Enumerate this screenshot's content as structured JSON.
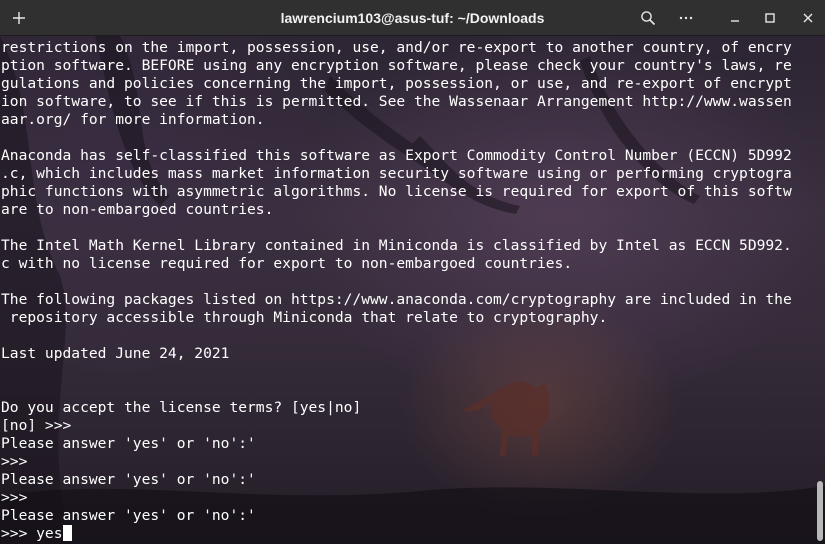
{
  "window": {
    "title": "lawrencium103@asus-tuf: ~/Downloads"
  },
  "toolbar": {
    "icons": [
      "plus-icon",
      "search-icon",
      "hamburger-menu-icon",
      "minimize-icon",
      "maximize-icon",
      "close-icon"
    ]
  },
  "terminal": {
    "lines": [
      "restrictions on the import, possession, use, and/or re-export to another country, of encry",
      "ption software. BEFORE using any encryption software, please check your country's laws, re",
      "gulations and policies concerning the import, possession, or use, and re-export of encrypt",
      "ion software, to see if this is permitted. See the Wassenaar Arrangement http://www.wassen",
      "aar.org/ for more information.",
      "",
      "Anaconda has self-classified this software as Export Commodity Control Number (ECCN) 5D992",
      ".c, which includes mass market information security software using or performing cryptogra",
      "phic functions with asymmetric algorithms. No license is required for export of this softw",
      "are to non-embargoed countries.",
      "",
      "The Intel Math Kernel Library contained in Miniconda is classified by Intel as ECCN 5D992.",
      "c with no license required for export to non-embargoed countries.",
      "",
      "The following packages listed on https://www.anaconda.com/cryptography are included in the",
      " repository accessible through Miniconda that relate to cryptography.",
      "",
      "Last updated June 24, 2021",
      "",
      "",
      "Do you accept the license terms? [yes|no]",
      "[no] >>>",
      "Please answer 'yes' or 'no':'",
      ">>>",
      "Please answer 'yes' or 'no':'",
      ">>>",
      "Please answer 'yes' or 'no':'"
    ],
    "prompt_line": ">>> yes"
  },
  "colors": {
    "titlebar": "#303030",
    "text": "#ffffff",
    "background": "#2d2533"
  }
}
